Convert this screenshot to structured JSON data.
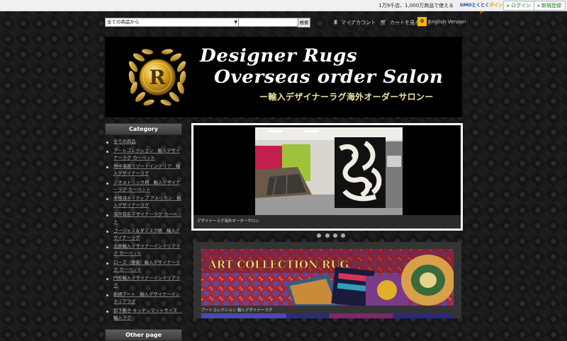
{
  "topbar": {
    "notice": "1万9千店、1,000万商品で使える",
    "gmo_badge_main": "GMOとくとく",
    "gmo_badge_points": "ポイント",
    "login": "ログイン",
    "register": "新規登録"
  },
  "search": {
    "category_selected": "全ての商品から",
    "query": "",
    "button": "検索"
  },
  "nav": {
    "my_account": "マイアカウント",
    "view_cart": "カートを見る",
    "cart_count": "0",
    "english": "English Version"
  },
  "header": {
    "emblem_letter": "R",
    "title_line1": "Designer Rugs",
    "title_line2": "Overseas order Salon",
    "subtitle": "ー輸入デザイナーラグ海外オーダーサロンー"
  },
  "sidebar": {
    "category_heading": "Category",
    "items": [
      "全ての商品",
      "アートコレクション　輸入デザイナーラグ·カーペット",
      "地中海風リゾートインテリア　輸入デザイナーラグ",
      "ジオメトリック柄　輸入デザイナーラグ·カーペット",
      "本格派ネイティブ·アメリカン　輸入デザイナーラグ",
      "海外有名デザイナーラグ·カーペット",
      "ゴージャス＆ダマスク柄　輸入デザイナーラグ",
      "北欧輸入デザイナーインテリアラグ·カーペット",
      "ローズ（薔薇）輸入デザイナーラグ·カーペット",
      "円形輸入デザイナーインテリアラグ",
      "新柄アート　輸入デザイナーインテリアラグ",
      "卸下敷き·キッチンマットサイズ　輸入ラグ"
    ],
    "other_heading": "Other page"
  },
  "slider": {
    "caption": "デザイナーラグ海外オーダーサロン",
    "dot_count": 4
  },
  "banner": {
    "title": "ART COLLECTION RUG",
    "caption": "アートコレクション 輸入デザイナーラグ"
  }
}
